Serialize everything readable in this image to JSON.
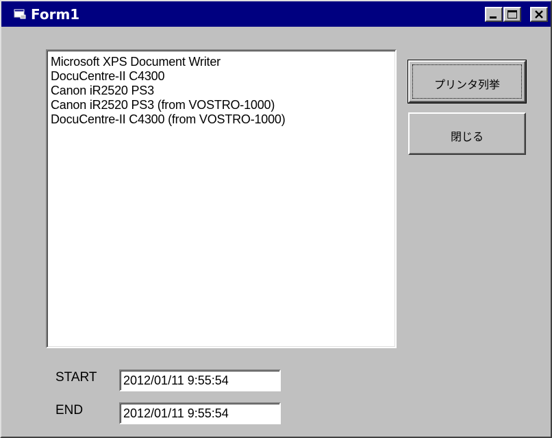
{
  "window": {
    "title": "Form1",
    "icon": "form-window-icon",
    "titlebar_color": "#000080",
    "face_color": "#c0c0c0"
  },
  "caption_buttons": {
    "minimize_icon": "minimize-icon",
    "maximize_icon": "maximize-icon",
    "close_icon": "close-icon"
  },
  "printer_list": {
    "items": [
      "Microsoft XPS Document Writer",
      "DocuCentre-II C4300",
      "Canon iR2520 PS3",
      "Canon iR2520 PS3 (from VOSTRO-1000)",
      "DocuCentre-II C4300 (from VOSTRO-1000)"
    ]
  },
  "buttons": {
    "enumerate_label": "プリンタ列挙",
    "close_label": "閉じる"
  },
  "times": {
    "start_label": "START",
    "start_value": "2012/01/11 9:55:54",
    "end_label": "END",
    "end_value": "2012/01/11 9:55:54"
  }
}
